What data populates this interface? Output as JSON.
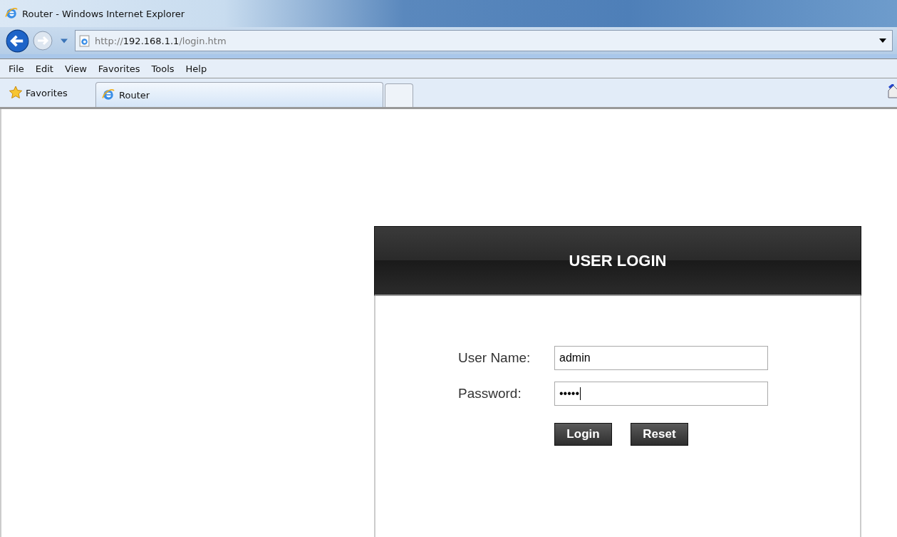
{
  "window": {
    "title": "Router - Windows Internet Explorer"
  },
  "address_bar": {
    "url_parts": [
      {
        "text": "http://",
        "emphasis": false
      },
      {
        "text": "192.168.1.1",
        "emphasis": true
      },
      {
        "text": "/login.htm",
        "emphasis": false
      }
    ]
  },
  "menu": [
    "File",
    "Edit",
    "View",
    "Favorites",
    "Tools",
    "Help"
  ],
  "favorites_bar": {
    "label": "Favorites",
    "tabs": [
      {
        "label": "Router",
        "selected": true
      }
    ]
  },
  "login": {
    "title": "USER LOGIN",
    "fields": [
      {
        "label": "User Name:",
        "value": "admin"
      },
      {
        "label": "Password:",
        "value": "•••••"
      }
    ],
    "buttons": [
      "Login",
      "Reset"
    ]
  }
}
